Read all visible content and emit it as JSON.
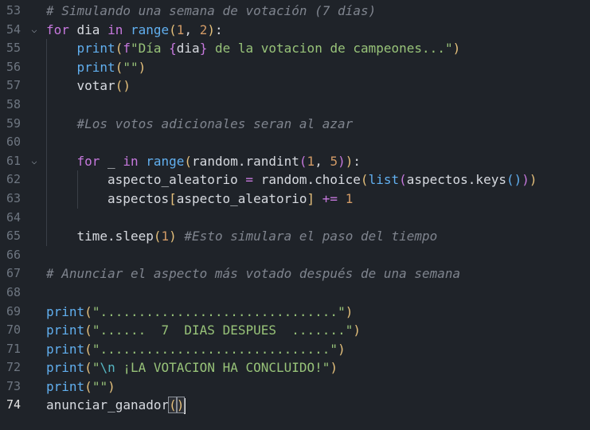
{
  "lines": [
    {
      "number": "53",
      "fold": "",
      "indent": 0,
      "tokens": [
        {
          "t": "# Simulando una semana de votación (7 días)",
          "c": "t-cm"
        }
      ]
    },
    {
      "number": "54",
      "fold": "⌵",
      "indent": 0,
      "tokens": [
        {
          "t": "for",
          "c": "t-kw"
        },
        {
          "t": " dia ",
          "c": "t-id"
        },
        {
          "t": "in",
          "c": "t-kw"
        },
        {
          "t": " ",
          "c": "t-id"
        },
        {
          "t": "range",
          "c": "t-fn"
        },
        {
          "t": "(",
          "c": "t-p1"
        },
        {
          "t": "1",
          "c": "t-num"
        },
        {
          "t": ", ",
          "c": "t-id"
        },
        {
          "t": "2",
          "c": "t-num"
        },
        {
          "t": ")",
          "c": "t-p1"
        },
        {
          "t": ":",
          "c": "t-id"
        }
      ]
    },
    {
      "number": "55",
      "fold": "",
      "indent": 1,
      "tokens": [
        {
          "t": "print",
          "c": "t-fn"
        },
        {
          "t": "(",
          "c": "t-p1"
        },
        {
          "t": "f",
          "c": "t-kw"
        },
        {
          "t": "\"Día ",
          "c": "t-str"
        },
        {
          "t": "{",
          "c": "t-interp"
        },
        {
          "t": "dia",
          "c": "t-id"
        },
        {
          "t": "}",
          "c": "t-interp"
        },
        {
          "t": " de la votacion de campeones...\"",
          "c": "t-str"
        },
        {
          "t": ")",
          "c": "t-p1"
        }
      ]
    },
    {
      "number": "56",
      "fold": "",
      "indent": 1,
      "tokens": [
        {
          "t": "print",
          "c": "t-fn"
        },
        {
          "t": "(",
          "c": "t-p1"
        },
        {
          "t": "\"\"",
          "c": "t-str"
        },
        {
          "t": ")",
          "c": "t-p1"
        }
      ]
    },
    {
      "number": "57",
      "fold": "",
      "indent": 1,
      "tokens": [
        {
          "t": "votar",
          "c": "t-id"
        },
        {
          "t": "()",
          "c": "t-p1"
        }
      ]
    },
    {
      "number": "58",
      "fold": "",
      "indent": 1,
      "tokens": []
    },
    {
      "number": "59",
      "fold": "",
      "indent": 1,
      "tokens": [
        {
          "t": "#Los votos adicionales seran al azar",
          "c": "t-cm"
        }
      ]
    },
    {
      "number": "60",
      "fold": "",
      "indent": 1,
      "tokens": []
    },
    {
      "number": "61",
      "fold": "⌵",
      "indent": 1,
      "tokens": [
        {
          "t": "for",
          "c": "t-kw"
        },
        {
          "t": " _ ",
          "c": "t-id"
        },
        {
          "t": "in",
          "c": "t-kw"
        },
        {
          "t": " ",
          "c": "t-id"
        },
        {
          "t": "range",
          "c": "t-fn"
        },
        {
          "t": "(",
          "c": "t-p1"
        },
        {
          "t": "random.randint",
          "c": "t-id"
        },
        {
          "t": "(",
          "c": "t-p2"
        },
        {
          "t": "1",
          "c": "t-num"
        },
        {
          "t": ", ",
          "c": "t-id"
        },
        {
          "t": "5",
          "c": "t-num"
        },
        {
          "t": ")",
          "c": "t-p2"
        },
        {
          "t": ")",
          "c": "t-p1"
        },
        {
          "t": ":",
          "c": "t-id"
        }
      ]
    },
    {
      "number": "62",
      "fold": "",
      "indent": 2,
      "tokens": [
        {
          "t": "aspecto_aleatorio ",
          "c": "t-id"
        },
        {
          "t": "=",
          "c": "t-op"
        },
        {
          "t": " random.choice",
          "c": "t-id"
        },
        {
          "t": "(",
          "c": "t-p1"
        },
        {
          "t": "list",
          "c": "t-fn"
        },
        {
          "t": "(",
          "c": "t-p2"
        },
        {
          "t": "aspectos.keys",
          "c": "t-id"
        },
        {
          "t": "()",
          "c": "t-p3"
        },
        {
          "t": ")",
          "c": "t-p2"
        },
        {
          "t": ")",
          "c": "t-p1"
        }
      ]
    },
    {
      "number": "63",
      "fold": "",
      "indent": 2,
      "tokens": [
        {
          "t": "aspectos",
          "c": "t-id"
        },
        {
          "t": "[",
          "c": "t-p1"
        },
        {
          "t": "aspecto_aleatorio",
          "c": "t-id"
        },
        {
          "t": "]",
          "c": "t-p1"
        },
        {
          "t": " ",
          "c": "t-id"
        },
        {
          "t": "+=",
          "c": "t-op"
        },
        {
          "t": " ",
          "c": "t-id"
        },
        {
          "t": "1",
          "c": "t-num"
        }
      ]
    },
    {
      "number": "64",
      "fold": "",
      "indent": 1,
      "tokens": []
    },
    {
      "number": "65",
      "fold": "",
      "indent": 1,
      "tokens": [
        {
          "t": "time.sleep",
          "c": "t-id"
        },
        {
          "t": "(",
          "c": "t-p1"
        },
        {
          "t": "1",
          "c": "t-num"
        },
        {
          "t": ")",
          "c": "t-p1"
        },
        {
          "t": " ",
          "c": "t-id"
        },
        {
          "t": "#Esto simulara el paso del tiempo",
          "c": "t-cm"
        }
      ]
    },
    {
      "number": "66",
      "fold": "",
      "indent": 0,
      "tokens": []
    },
    {
      "number": "67",
      "fold": "",
      "indent": 0,
      "tokens": [
        {
          "t": "# Anunciar el aspecto más votado después de una semana",
          "c": "t-cm"
        }
      ]
    },
    {
      "number": "68",
      "fold": "",
      "indent": 0,
      "tokens": []
    },
    {
      "number": "69",
      "fold": "",
      "indent": 0,
      "tokens": [
        {
          "t": "print",
          "c": "t-fn"
        },
        {
          "t": "(",
          "c": "t-p1"
        },
        {
          "t": "\"...............................\"",
          "c": "t-str"
        },
        {
          "t": ")",
          "c": "t-p1"
        }
      ]
    },
    {
      "number": "70",
      "fold": "",
      "indent": 0,
      "tokens": [
        {
          "t": "print",
          "c": "t-fn"
        },
        {
          "t": "(",
          "c": "t-p1"
        },
        {
          "t": "\"......  7  DIAS DESPUES  .......\"",
          "c": "t-str"
        },
        {
          "t": ")",
          "c": "t-p1"
        }
      ]
    },
    {
      "number": "71",
      "fold": "",
      "indent": 0,
      "tokens": [
        {
          "t": "print",
          "c": "t-fn"
        },
        {
          "t": "(",
          "c": "t-p1"
        },
        {
          "t": "\"..............................\"",
          "c": "t-str"
        },
        {
          "t": ")",
          "c": "t-p1"
        }
      ]
    },
    {
      "number": "72",
      "fold": "",
      "indent": 0,
      "tokens": [
        {
          "t": "print",
          "c": "t-fn"
        },
        {
          "t": "(",
          "c": "t-p1"
        },
        {
          "t": "\"",
          "c": "t-str"
        },
        {
          "t": "\\n",
          "c": "t-esc"
        },
        {
          "t": " ¡LA VOTACION HA CONCLUIDO!\"",
          "c": "t-str"
        },
        {
          "t": ")",
          "c": "t-p1"
        }
      ]
    },
    {
      "number": "73",
      "fold": "",
      "indent": 0,
      "tokens": [
        {
          "t": "print",
          "c": "t-fn"
        },
        {
          "t": "(",
          "c": "t-p1"
        },
        {
          "t": "\"\"",
          "c": "t-str"
        },
        {
          "t": ")",
          "c": "t-p1"
        }
      ]
    },
    {
      "number": "74",
      "fold": "",
      "indent": 0,
      "current": true,
      "tokens": [
        {
          "t": "anunciar_ganador",
          "c": "t-id"
        },
        {
          "t": "(",
          "c": "t-p1",
          "match": true
        },
        {
          "t": ")",
          "c": "t-p1",
          "match": true
        }
      ]
    }
  ]
}
